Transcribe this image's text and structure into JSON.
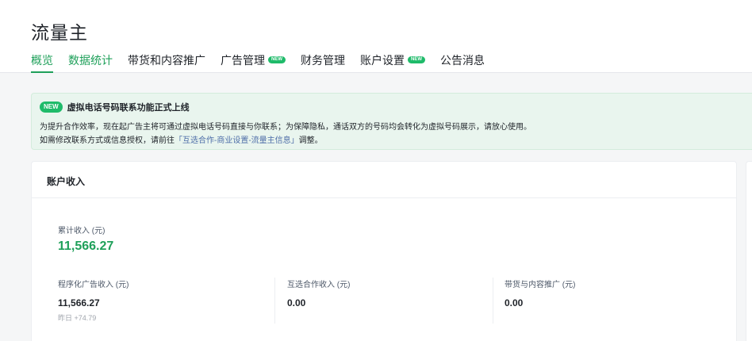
{
  "page": {
    "title": "流量主"
  },
  "tabs": [
    {
      "label": "概览",
      "active": true,
      "badge": ""
    },
    {
      "label": "数据统计",
      "active": false,
      "badge": ""
    },
    {
      "label": "带货和内容推广",
      "active": false,
      "badge": ""
    },
    {
      "label": "广告管理",
      "active": false,
      "badge": "NEW"
    },
    {
      "label": "财务管理",
      "active": false,
      "badge": ""
    },
    {
      "label": "账户设置",
      "active": false,
      "badge": "NEW"
    },
    {
      "label": "公告消息",
      "active": false,
      "badge": ""
    }
  ],
  "notice": {
    "badge": "NEW",
    "title": "虚拟电话号码联系功能正式上线",
    "line1": "为提升合作效率，现在起广告主将可通过虚拟电话号码直接与你联系；为保障隐私，通话双方的号码均会转化为虚拟号码展示，请放心使用。",
    "line2_prefix": "如需修改联系方式或信息授权，请前往",
    "line2_link": "「互选合作-商业设置-流量主信息」",
    "line2_suffix": "调整。"
  },
  "account_income": {
    "title": "账户收入",
    "total_label": "累计收入 (元)",
    "total_value": "11,566.27",
    "metrics": [
      {
        "label": "程序化广告收入 (元)",
        "value": "11,566.27",
        "sub": "昨日 +74.79"
      },
      {
        "label": "互选合作收入 (元)",
        "value": "0.00",
        "sub": ""
      },
      {
        "label": "带货与内容推广 (元)",
        "value": "0.00",
        "sub": ""
      }
    ]
  },
  "colors": {
    "accent": "#1fa05a",
    "badge": "#1fbb6a",
    "notice_bg": "#e9f5ee",
    "link": "#4e6ea8"
  }
}
